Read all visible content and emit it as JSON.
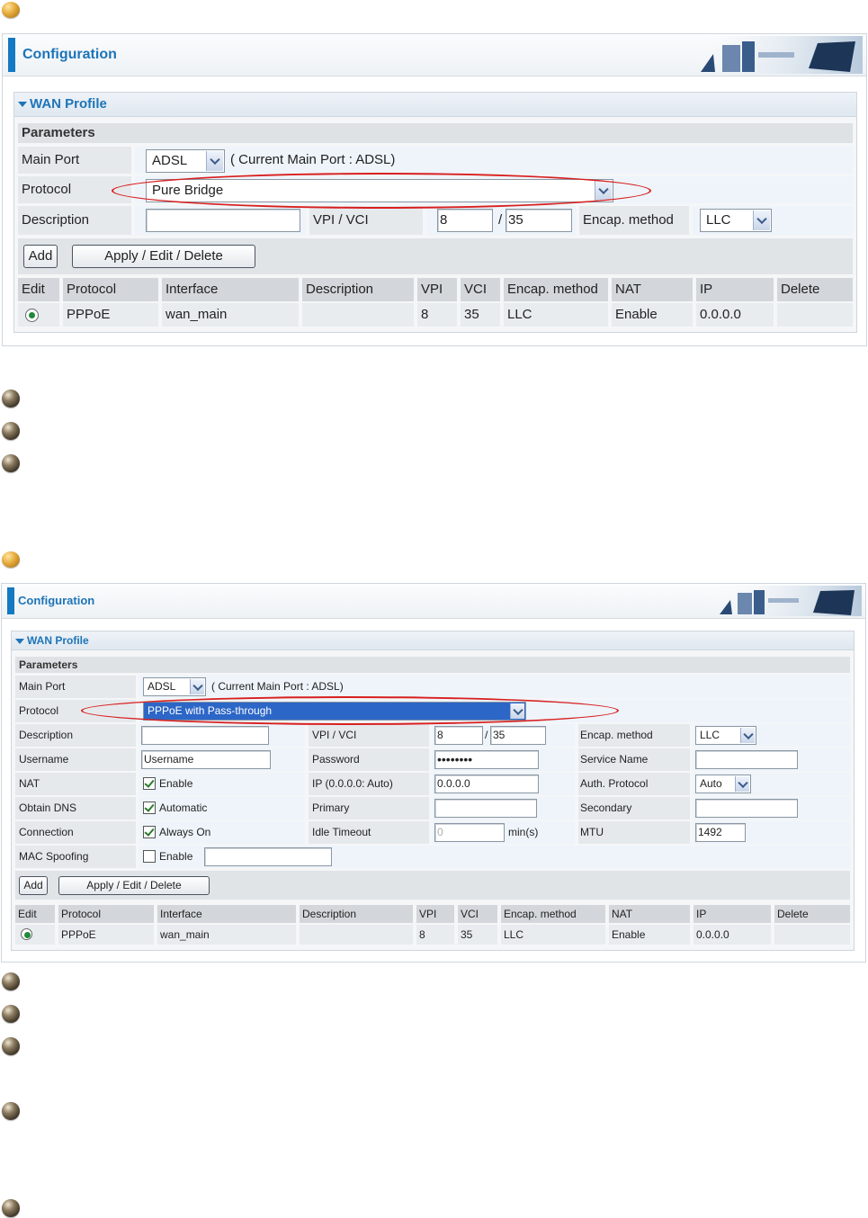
{
  "panel1": {
    "title": "Configuration",
    "section": "WAN Profile",
    "params_title": "Parameters",
    "main_port_label": "Main Port",
    "main_port_value": "ADSL",
    "current_main_port": "( Current Main Port : ADSL)",
    "protocol_label": "Protocol",
    "protocol_value": "Pure Bridge",
    "description_label": "Description",
    "description_value": "",
    "vpi_vci_label": "VPI / VCI",
    "vpi": "8",
    "slash": "/",
    "vci": "35",
    "encap_label": "Encap. method",
    "encap_value": "LLC",
    "add_label": "Add",
    "apply_label": "Apply / Edit / Delete",
    "table_headers": [
      "Edit",
      "Protocol",
      "Interface",
      "Description",
      "VPI",
      "VCI",
      "Encap. method",
      "NAT",
      "IP",
      "Delete"
    ],
    "table_row": {
      "protocol": "PPPoE",
      "interface": "wan_main",
      "description": "",
      "vpi": "8",
      "vci": "35",
      "encap": "LLC",
      "nat": "Enable",
      "ip": "0.0.0.0"
    }
  },
  "panel2": {
    "title": "Configuration",
    "section": "WAN Profile",
    "params_title": "Parameters",
    "main_port_label": "Main Port",
    "main_port_value": "ADSL",
    "current_main_port": "( Current Main Port : ADSL)",
    "protocol_label": "Protocol",
    "protocol_value": "PPPoE with Pass-through",
    "description_label": "Description",
    "vpi_vci_label": "VPI / VCI",
    "vpi": "8",
    "slash": "/",
    "vci": "35",
    "encap_label": "Encap. method",
    "encap_value": "LLC",
    "username_label": "Username",
    "username_value": "Username",
    "password_label": "Password",
    "password_value": "••••••••",
    "service_name_label": "Service Name",
    "nat_label": "NAT",
    "nat_check_label": "Enable",
    "ip_label": "IP (0.0.0.0: Auto)",
    "ip_value": "0.0.0.0",
    "auth_label": "Auth. Protocol",
    "auth_value": "Auto",
    "dns_label": "Obtain DNS",
    "dns_check_label": "Automatic",
    "primary_label": "Primary",
    "secondary_label": "Secondary",
    "connection_label": "Connection",
    "connection_check_label": "Always On",
    "idle_label": "Idle Timeout",
    "idle_value": "0",
    "idle_unit": "min(s)",
    "mtu_label": "MTU",
    "mtu_value": "1492",
    "mac_label": "MAC Spoofing",
    "mac_check_label": "Enable",
    "add_label": "Add",
    "apply_label": "Apply / Edit / Delete",
    "table_headers": [
      "Edit",
      "Protocol",
      "Interface",
      "Description",
      "VPI",
      "VCI",
      "Encap. method",
      "NAT",
      "IP",
      "Delete"
    ],
    "table_row": {
      "protocol": "PPPoE",
      "interface": "wan_main",
      "description": "",
      "vpi": "8",
      "vci": "35",
      "encap": "LLC",
      "nat": "Enable",
      "ip": "0.0.0.0"
    }
  },
  "colors": {
    "accent": "#1d74b8",
    "highlight": "#d81f1f",
    "selection": "#2c66c7"
  },
  "icons": [
    "gold-bullet-icon",
    "dark-bullet-icon",
    "dropdown-arrow-icon",
    "radio-icon",
    "checkbox-icon",
    "collapse-triangle-icon"
  ]
}
